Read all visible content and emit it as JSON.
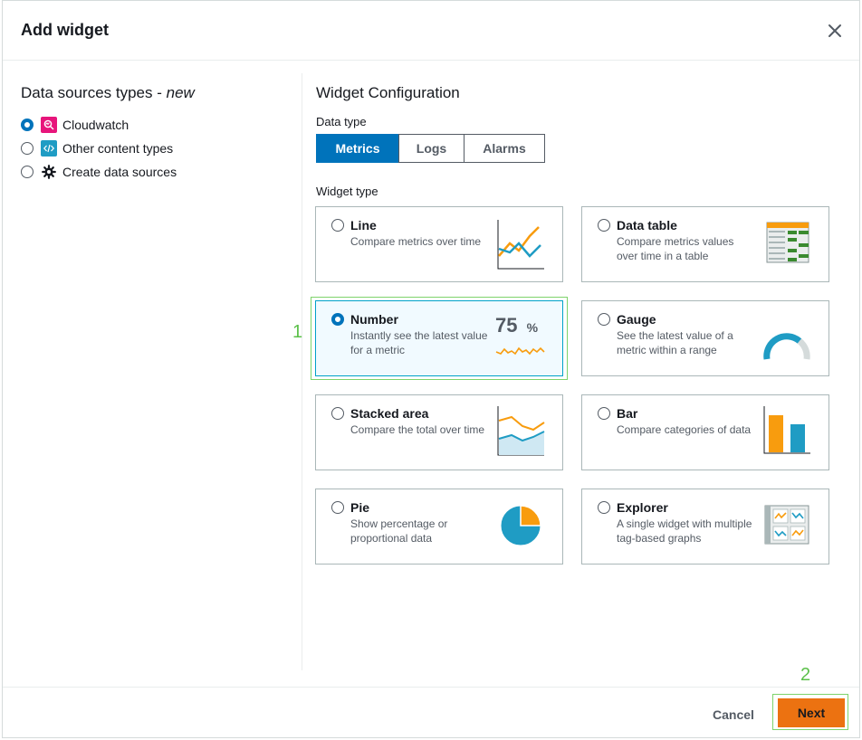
{
  "dialog": {
    "title": "Add widget"
  },
  "sources": {
    "heading": "Data sources types - ",
    "heading_suffix": "new",
    "items": [
      {
        "label": "Cloudwatch",
        "selected": true,
        "icon": "cloudwatch-icon",
        "icon_color": "#e7157b"
      },
      {
        "label": "Other content types",
        "selected": false,
        "icon": "code-icon",
        "icon_color": "#1f9cc4"
      },
      {
        "label": "Create data sources",
        "selected": false,
        "icon": "gear-icon",
        "icon_color": "#16191f"
      }
    ]
  },
  "config": {
    "heading": "Widget Configuration",
    "data_type_label": "Data type",
    "data_types": [
      {
        "label": "Metrics",
        "active": true
      },
      {
        "label": "Logs",
        "active": false
      },
      {
        "label": "Alarms",
        "active": false
      }
    ],
    "widget_type_label": "Widget type",
    "widgets": [
      {
        "title": "Line",
        "desc": "Compare metrics over time",
        "selected": false,
        "icon": "line-chart-icon"
      },
      {
        "title": "Data table",
        "desc": "Compare metrics values over time in a table",
        "selected": false,
        "icon": "data-table-icon"
      },
      {
        "title": "Number",
        "desc": "Instantly see the latest value for a metric",
        "selected": true,
        "icon": "number-icon",
        "icon_value": "75",
        "icon_unit": "%"
      },
      {
        "title": "Gauge",
        "desc": "See the latest value of a metric within a range",
        "selected": false,
        "icon": "gauge-icon"
      },
      {
        "title": "Stacked area",
        "desc": "Compare the total over time",
        "selected": false,
        "icon": "stacked-area-icon"
      },
      {
        "title": "Bar",
        "desc": "Compare categories of data",
        "selected": false,
        "icon": "bar-chart-icon"
      },
      {
        "title": "Pie",
        "desc": "Show percentage or proportional data",
        "selected": false,
        "icon": "pie-chart-icon"
      },
      {
        "title": "Explorer",
        "desc": "A single widget with multiple tag-based graphs",
        "selected": false,
        "icon": "explorer-icon"
      }
    ]
  },
  "footer": {
    "cancel_label": "Cancel",
    "next_label": "Next"
  },
  "annotations": [
    "1",
    "2"
  ],
  "colors": {
    "accent": "#0073bb",
    "primary_button": "#ec7211",
    "chart_orange": "#f89c0e",
    "chart_teal": "#1f9cc4",
    "annotation_green": "#5cc04a"
  }
}
